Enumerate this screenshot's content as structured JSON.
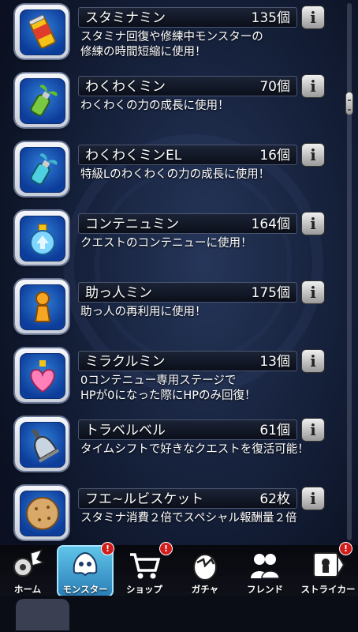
{
  "items": [
    {
      "name": "スタミナミン",
      "count": "135個",
      "desc_lines": [
        "スタミナ回復や修練中モンスターの",
        "修練の時間短縮に使用！"
      ],
      "icon": "stamina-can-icon",
      "icon_color": "#f5c21a"
    },
    {
      "name": "わくわくミン",
      "count": "70個",
      "desc_lines": [
        "わくわくの力の成長に使用！"
      ],
      "icon": "sprout-bottle-icon",
      "icon_color": "#7ac943"
    },
    {
      "name": "わくわくミンEL",
      "count": "16個",
      "desc_lines": [
        "特級Lのわくわくの力の成長に使用！"
      ],
      "icon": "sprout-bottle-el-icon",
      "icon_color": "#4fd0e0"
    },
    {
      "name": "コンテニュミン",
      "count": "164個",
      "desc_lines": [
        "クエストのコンテニューに使用！"
      ],
      "icon": "continue-potion-icon",
      "icon_color": "#7fd6ff"
    },
    {
      "name": "助っ人ミン",
      "count": "175個",
      "desc_lines": [
        "助っ人の再利用に使用！"
      ],
      "icon": "helper-figure-icon",
      "icon_color": "#f5a623"
    },
    {
      "name": "ミラクルミン",
      "count": "13個",
      "desc_lines": [
        "0コンテニュー専用ステージで",
        "HPが0になった際にHPのみ回復！"
      ],
      "icon": "heart-potion-icon",
      "icon_color": "#ff7fb8"
    },
    {
      "name": "トラベルベル",
      "count": "61個",
      "desc_lines": [
        "タイムシフトで好きなクエストを復活可能！"
      ],
      "icon": "bell-icon",
      "icon_color": "#c8d4e0"
    },
    {
      "name": "フエ~ルビスケット",
      "count": "62枚",
      "desc_lines": [
        "スタミナ消費２倍でスペシャル報酬量２倍"
      ],
      "icon": "biscuit-icon",
      "icon_color": "#d9a96a"
    }
  ],
  "info_glyph": "i",
  "tabs": [
    {
      "label": "ホーム",
      "icon": "home-gear-icon",
      "badge": ""
    },
    {
      "label": "モンスター",
      "icon": "monster-icon",
      "badge": "!"
    },
    {
      "label": "ショップ",
      "icon": "shopping-cart-icon",
      "badge": "!"
    },
    {
      "label": "ガチャ",
      "icon": "gacha-egg-icon",
      "badge": ""
    },
    {
      "label": "フレンド",
      "icon": "friends-icon",
      "badge": ""
    },
    {
      "label": "ストライカー",
      "icon": "striker-card-icon",
      "badge": "!"
    }
  ],
  "colors": {
    "badge": "#d21c1c",
    "active_tab": "#3aa0d6"
  }
}
